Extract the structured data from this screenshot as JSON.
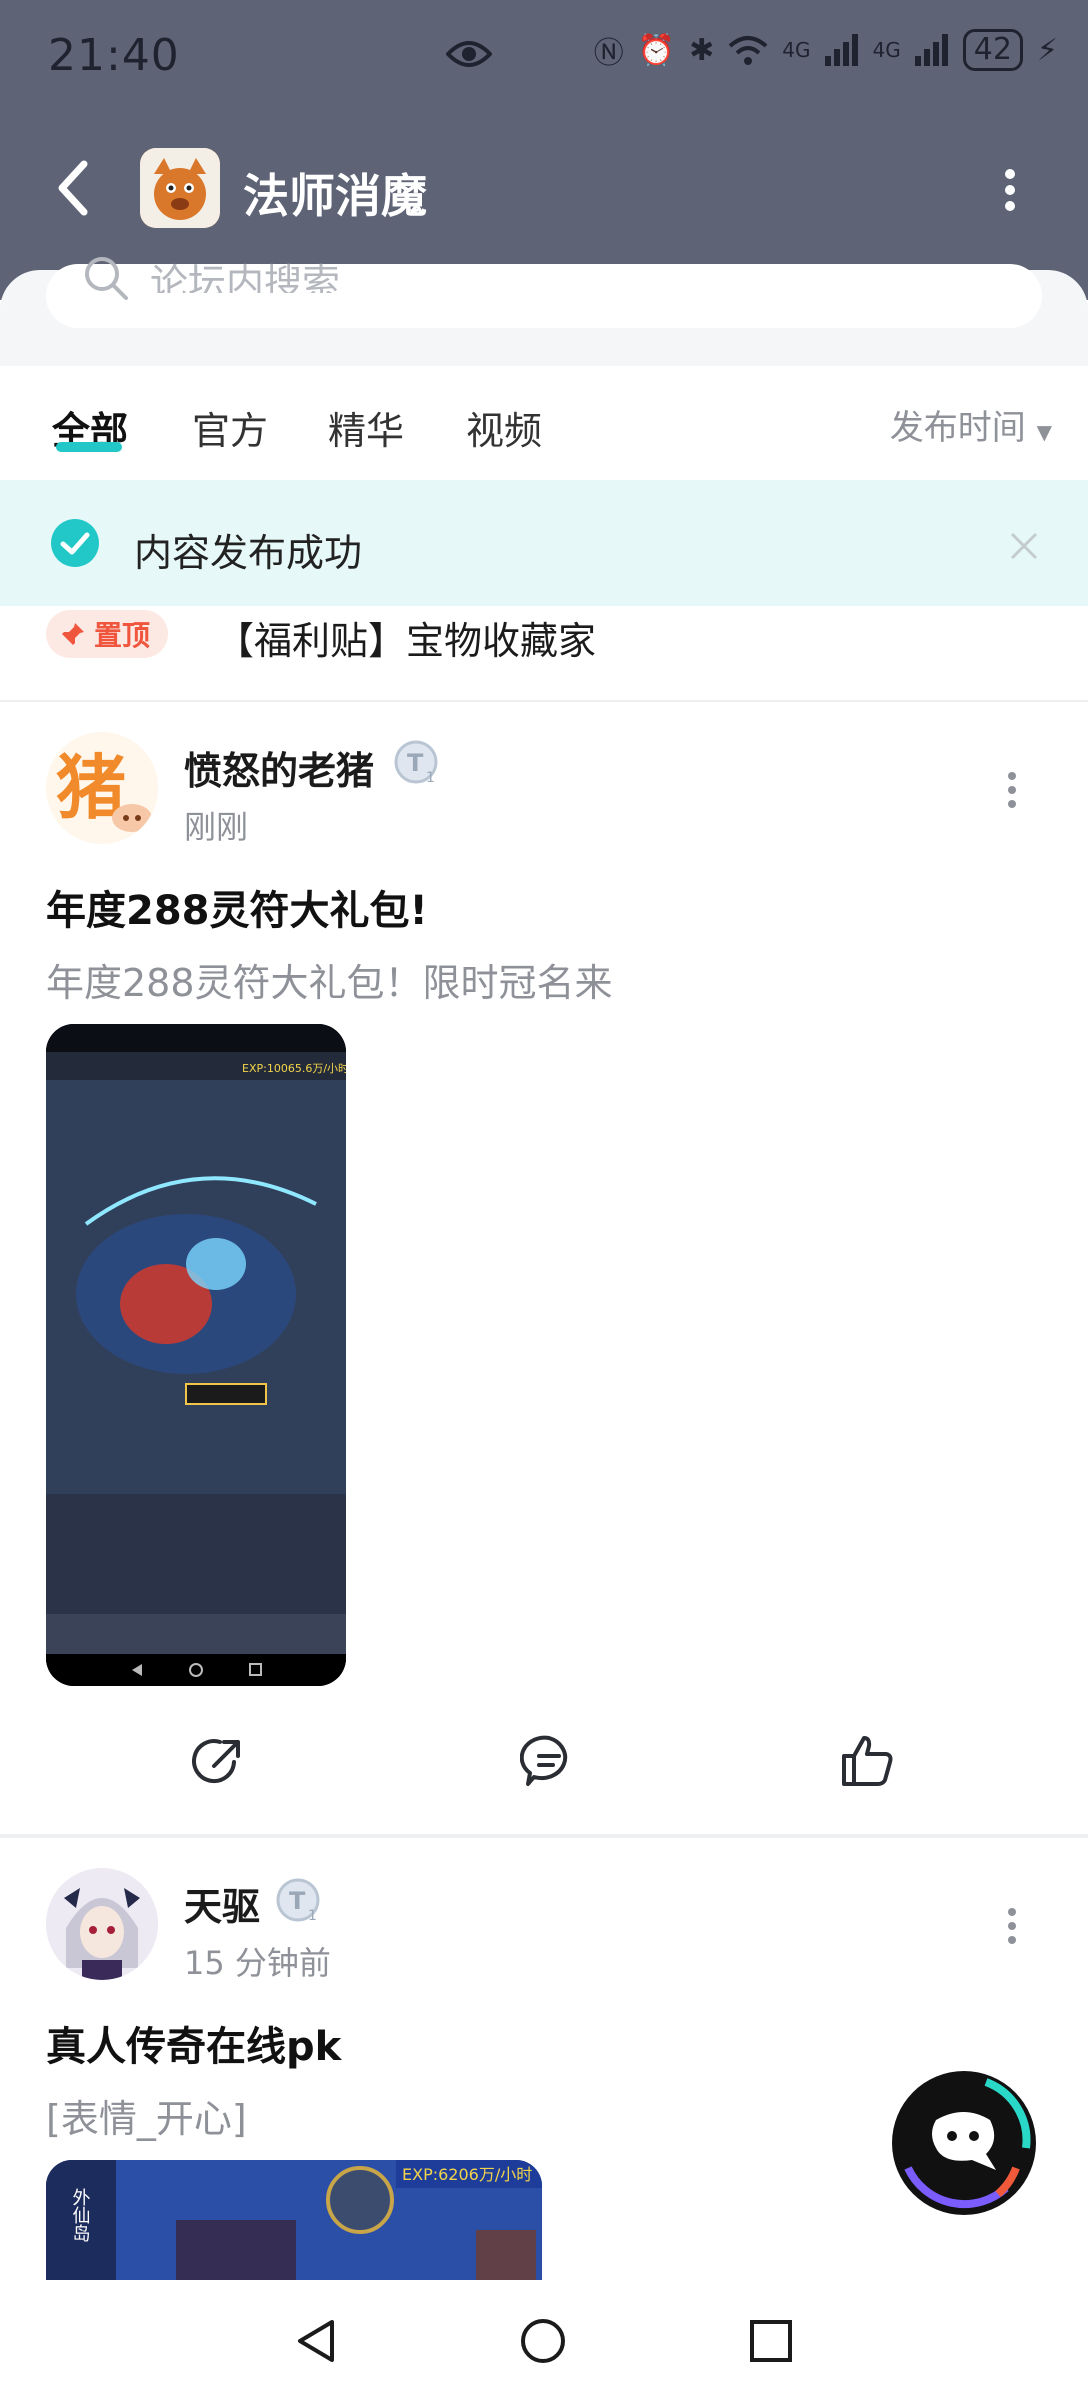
{
  "status_bar": {
    "time": "21:40",
    "network_1": "4G",
    "network_2": "4G",
    "battery": "42"
  },
  "header": {
    "title": "法师消魔",
    "app_icon": "forum-app-icon"
  },
  "search": {
    "placeholder": "论坛内搜索"
  },
  "tabs": [
    {
      "label": "全部",
      "active": true
    },
    {
      "label": "官方",
      "active": false
    },
    {
      "label": "精华",
      "active": false
    },
    {
      "label": "视频",
      "active": false
    }
  ],
  "sort": {
    "label": "发布时间"
  },
  "toast": {
    "message": "内容发布成功"
  },
  "pinned": {
    "badge": "置顶",
    "title": "【福利贴】宝物收藏家"
  },
  "posts": [
    {
      "author": "愤怒的老猪",
      "time": "刚刚",
      "title": "年度288灵符大礼包!",
      "body": "年度288灵符大礼包！限时冠名来",
      "avatar_char": "猪",
      "image_text": "EXP:10065.6万/小时"
    },
    {
      "author": "天驱",
      "time": "15 分钟前",
      "title": "真人传奇在线pk",
      "body": "[表情_开心]",
      "image_text": "EXP:6206万/小时",
      "image_side": "外仙岛"
    }
  ],
  "colors": {
    "header_bg": "#5e6476",
    "accent": "#22c8c8",
    "toast_bg": "#e6f8f7",
    "pin_red": "#f0553e"
  }
}
